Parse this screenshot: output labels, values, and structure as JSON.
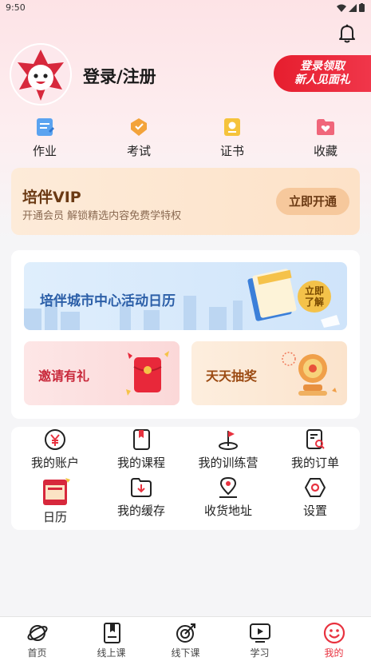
{
  "status_bar": {
    "time": "9:50"
  },
  "colors": {
    "accent": "#e8323f",
    "vip_text": "#6b3a14",
    "calendar_blue": "#2c5fa8"
  },
  "profile": {
    "login_label": "登录/注册",
    "promo_line1": "登录领取",
    "promo_line2": "新人见面礼"
  },
  "quick_actions": [
    {
      "label": "作业",
      "icon": "homework-icon"
    },
    {
      "label": "考试",
      "icon": "exam-icon"
    },
    {
      "label": "证书",
      "icon": "certificate-icon"
    },
    {
      "label": "收藏",
      "icon": "favorite-icon"
    }
  ],
  "vip": {
    "title": "培伴VIP",
    "subtitle": "开通会员 解锁精选内容免费学特权",
    "button": "立即开通"
  },
  "activity": {
    "calendar_title": "培伴城市中心活动日历",
    "join_badge_line1": "立即",
    "join_badge_line2": "了解",
    "invite_label": "邀请有礼",
    "lottery_label": "天天抽奖"
  },
  "menu": [
    {
      "label": "我的账户",
      "icon": "wallet-icon"
    },
    {
      "label": "我的课程",
      "icon": "course-book-icon"
    },
    {
      "label": "我的训练营",
      "icon": "camp-flag-icon"
    },
    {
      "label": "我的订单",
      "icon": "order-search-icon"
    },
    {
      "label": "日历",
      "icon": "calendar-icon"
    },
    {
      "label": "我的缓存",
      "icon": "download-folder-icon"
    },
    {
      "label": "收货地址",
      "icon": "location-icon"
    },
    {
      "label": "设置",
      "icon": "settings-icon"
    }
  ],
  "tabs": [
    {
      "label": "首页",
      "icon": "home-planet-icon",
      "active": false
    },
    {
      "label": "线上课",
      "icon": "online-course-icon",
      "active": false
    },
    {
      "label": "线下课",
      "icon": "offline-target-icon",
      "active": false
    },
    {
      "label": "学习",
      "icon": "play-video-icon",
      "active": false
    },
    {
      "label": "我的",
      "icon": "smiley-profile-icon",
      "active": true
    }
  ]
}
